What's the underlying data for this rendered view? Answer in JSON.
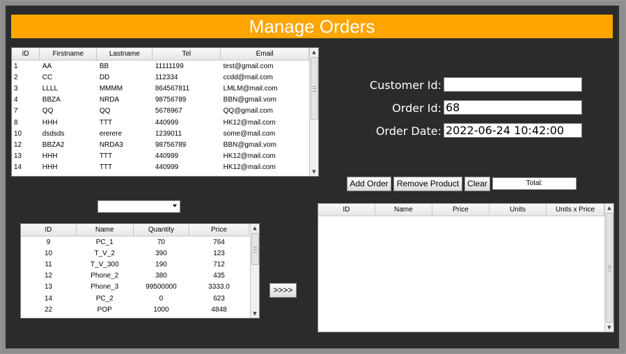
{
  "title": "Manage Orders",
  "customers": {
    "columns": [
      "ID",
      "Firstname",
      "Lastname",
      "Tel",
      "Email"
    ],
    "rows": [
      [
        "1",
        "AA",
        "BB",
        "11111199",
        "test@gmail.com"
      ],
      [
        "2",
        "CC",
        "DD",
        "112334",
        "ccdd@mail.com"
      ],
      [
        "3",
        "LLLL",
        "MMMM",
        "864567811",
        "LMLM@mail.com"
      ],
      [
        "4",
        "BBZA",
        "NRDA",
        "98756789",
        "BBN@gmail.vom"
      ],
      [
        "7",
        "QQ",
        "QQ",
        "5678967",
        "QQ@gmail.com"
      ],
      [
        "8",
        "HHH",
        "TTT",
        "440999",
        "HK12@mail.com"
      ],
      [
        "10",
        "dsdsds",
        "ererere",
        "1239011",
        "some@mail.com"
      ],
      [
        "12",
        "BBZA2",
        "NRDA3",
        "98756789",
        "BBN@gmail.vom"
      ],
      [
        "13",
        "HHH",
        "TTT",
        "440999",
        "HK12@mail.com"
      ],
      [
        "14",
        "HHH",
        "TTT",
        "440999",
        "HK12@mail.com"
      ]
    ]
  },
  "form": {
    "customer_id_label": "Customer Id:",
    "customer_id_value": "",
    "order_id_label": "Order Id:",
    "order_id_value": "68",
    "order_date_label": "Order Date:",
    "order_date_value": "2022-06-24 10:42:00"
  },
  "buttons": {
    "add_order": "Add Order",
    "remove_product": "Remove Product",
    "clear": "Clear",
    "transfer": ">>>>"
  },
  "total_label": "Total:",
  "category_combo": {
    "selected": "",
    "icon": "chevron-down-icon"
  },
  "products": {
    "columns": [
      "ID",
      "Name",
      "Quantity",
      "Price"
    ],
    "rows": [
      [
        "9",
        "PC_1",
        "70",
        "764"
      ],
      [
        "10",
        "T_V_2",
        "390",
        "123"
      ],
      [
        "11",
        "T_V_300",
        "190",
        "712"
      ],
      [
        "12",
        "Phone_2",
        "380",
        "435"
      ],
      [
        "13",
        "Phone_3",
        "99500000",
        "3333.0"
      ],
      [
        "14",
        "PC_2",
        "0",
        "623"
      ],
      [
        "22",
        "POP",
        "1000",
        "4848"
      ]
    ]
  },
  "order_items": {
    "columns": [
      "ID",
      "Name",
      "Price",
      "Units",
      "Units x Price"
    ],
    "rows": []
  },
  "colors": {
    "header": "#ffa500",
    "panel": "#2a2c2b",
    "frame": "#8e8e8e"
  }
}
